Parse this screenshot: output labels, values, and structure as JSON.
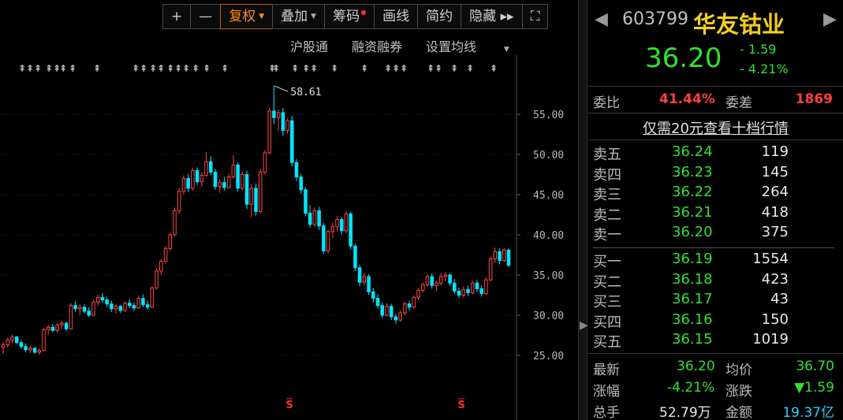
{
  "toolbar": {
    "plus": "+",
    "minus": "—",
    "fuquan": "复权",
    "diejia": "叠加",
    "chouma": "筹码",
    "huaxian": "画线",
    "jianyue": "简约",
    "yincang": "隐藏 ▸▸",
    "expand": "⛶"
  },
  "subbar": {
    "hugutong": "沪股通",
    "rongzi": "融资融券",
    "settings": "设置均线"
  },
  "chart_data": {
    "type": "candlestick",
    "yticks": [
      "55.00",
      "50.00",
      "45.00",
      "40.00",
      "35.00",
      "30.00",
      "25.00"
    ],
    "ylim": [
      20.4,
      60.5
    ],
    "max_label": "58.61",
    "marker_s": "S",
    "candles": [
      [
        26.0,
        26.6,
        25.2,
        26.3
      ],
      [
        26.3,
        27.2,
        26.0,
        26.9
      ],
      [
        26.9,
        27.6,
        26.5,
        27.3
      ],
      [
        27.3,
        27.4,
        26.4,
        26.6
      ],
      [
        26.6,
        26.9,
        25.8,
        26.1
      ],
      [
        26.1,
        26.5,
        25.4,
        25.7
      ],
      [
        25.7,
        26.2,
        25.3,
        25.9
      ],
      [
        25.9,
        26.0,
        25.2,
        25.4
      ],
      [
        25.4,
        25.9,
        25.1,
        25.6
      ],
      [
        25.6,
        28.4,
        25.5,
        28.2
      ],
      [
        28.2,
        28.8,
        27.6,
        28.5
      ],
      [
        28.5,
        28.9,
        27.9,
        28.1
      ],
      [
        28.1,
        29.0,
        27.8,
        28.8
      ],
      [
        28.8,
        29.3,
        28.3,
        29.0
      ],
      [
        29.0,
        29.2,
        28.0,
        28.3
      ],
      [
        28.3,
        31.5,
        28.2,
        31.2
      ],
      [
        31.2,
        31.8,
        30.4,
        30.8
      ],
      [
        30.8,
        31.3,
        30.0,
        31.0
      ],
      [
        31.0,
        31.4,
        30.2,
        30.5
      ],
      [
        30.5,
        31.0,
        29.8,
        30.0
      ],
      [
        30.0,
        31.9,
        29.9,
        31.6
      ],
      [
        31.6,
        32.6,
        31.2,
        32.2
      ],
      [
        32.2,
        32.8,
        31.5,
        31.9
      ],
      [
        31.9,
        32.3,
        31.0,
        31.4
      ],
      [
        31.4,
        31.8,
        30.4,
        30.8
      ],
      [
        30.8,
        31.4,
        30.2,
        31.1
      ],
      [
        31.1,
        31.3,
        30.3,
        30.6
      ],
      [
        30.6,
        31.7,
        30.4,
        31.5
      ],
      [
        31.5,
        32.0,
        30.9,
        31.2
      ],
      [
        31.2,
        31.6,
        30.5,
        30.9
      ],
      [
        30.9,
        32.4,
        30.8,
        32.1
      ],
      [
        32.1,
        32.6,
        31.0,
        31.3
      ],
      [
        31.3,
        31.8,
        30.7,
        31.0
      ],
      [
        31.0,
        33.6,
        30.9,
        33.4
      ],
      [
        33.4,
        35.8,
        33.2,
        35.5
      ],
      [
        35.5,
        37.0,
        35.0,
        36.7
      ],
      [
        36.7,
        38.6,
        36.4,
        38.3
      ],
      [
        38.3,
        40.3,
        38.0,
        40.0
      ],
      [
        40.0,
        43.4,
        39.8,
        43.0
      ],
      [
        43.0,
        45.8,
        42.6,
        45.4
      ],
      [
        45.4,
        47.4,
        45.0,
        47.0
      ],
      [
        47.0,
        47.6,
        45.3,
        45.8
      ],
      [
        45.8,
        48.3,
        45.5,
        48.0
      ],
      [
        48.0,
        48.4,
        46.2,
        46.6
      ],
      [
        46.6,
        47.8,
        46.0,
        47.4
      ],
      [
        47.4,
        50.3,
        47.2,
        49.1
      ],
      [
        49.1,
        49.8,
        47.4,
        47.8
      ],
      [
        47.8,
        48.2,
        45.6,
        46.0
      ],
      [
        46.0,
        46.9,
        45.2,
        46.5
      ],
      [
        46.5,
        47.2,
        45.5,
        45.9
      ],
      [
        45.9,
        47.6,
        45.7,
        47.2
      ],
      [
        47.2,
        49.9,
        47.0,
        48.7
      ],
      [
        48.7,
        49.0,
        45.4,
        45.8
      ],
      [
        45.8,
        47.9,
        45.5,
        47.5
      ],
      [
        47.5,
        48.0,
        43.2,
        43.8
      ],
      [
        43.8,
        46.3,
        42.2,
        45.8
      ],
      [
        45.8,
        46.4,
        42.4,
        42.9
      ],
      [
        42.9,
        48.2,
        42.7,
        47.8
      ],
      [
        47.8,
        50.5,
        47.5,
        50.2
      ],
      [
        50.2,
        55.8,
        50.0,
        55.4
      ],
      [
        55.4,
        58.61,
        53.8,
        54.6
      ],
      [
        54.6,
        55.6,
        53.0,
        55.2
      ],
      [
        55.2,
        55.8,
        52.3,
        53.0
      ],
      [
        53.0,
        54.5,
        52.6,
        54.2
      ],
      [
        54.2,
        54.8,
        48.5,
        49.0
      ],
      [
        49.0,
        49.4,
        46.7,
        47.2
      ],
      [
        47.2,
        47.6,
        45.1,
        45.6
      ],
      [
        45.6,
        45.9,
        42.3,
        42.7
      ],
      [
        42.7,
        43.7,
        40.9,
        41.3
      ],
      [
        41.3,
        43.4,
        41.0,
        43.0
      ],
      [
        43.0,
        43.5,
        40.6,
        41.1
      ],
      [
        41.1,
        41.5,
        37.6,
        38.0
      ],
      [
        38.0,
        40.7,
        37.7,
        40.4
      ],
      [
        40.4,
        41.5,
        39.6,
        41.0
      ],
      [
        41.0,
        42.3,
        40.4,
        41.9
      ],
      [
        41.9,
        42.2,
        40.0,
        40.5
      ],
      [
        40.5,
        43.0,
        40.2,
        42.6
      ],
      [
        42.6,
        42.9,
        38.2,
        38.6
      ],
      [
        38.6,
        38.9,
        35.5,
        35.9
      ],
      [
        35.9,
        36.3,
        33.6,
        34.1
      ],
      [
        34.1,
        35.3,
        33.7,
        34.8
      ],
      [
        34.8,
        35.1,
        32.5,
        32.9
      ],
      [
        32.9,
        33.4,
        31.6,
        32.1
      ],
      [
        32.1,
        32.6,
        30.8,
        31.2
      ],
      [
        31.2,
        31.6,
        29.6,
        30.0
      ],
      [
        30.0,
        31.5,
        29.8,
        31.1
      ],
      [
        31.1,
        31.4,
        29.4,
        29.8
      ],
      [
        29.8,
        30.2,
        28.9,
        29.4
      ],
      [
        29.4,
        30.6,
        29.2,
        30.3
      ],
      [
        30.3,
        31.7,
        30.0,
        31.4
      ],
      [
        31.4,
        31.8,
        30.6,
        31.0
      ],
      [
        31.0,
        32.5,
        30.8,
        32.2
      ],
      [
        32.2,
        33.4,
        31.9,
        33.1
      ],
      [
        33.1,
        34.1,
        32.8,
        33.8
      ],
      [
        33.8,
        35.1,
        33.5,
        34.8
      ],
      [
        34.8,
        35.2,
        33.3,
        33.7
      ],
      [
        33.7,
        34.3,
        33.0,
        34.0
      ],
      [
        34.0,
        35.2,
        33.7,
        34.8
      ],
      [
        34.8,
        35.4,
        34.2,
        35.0
      ],
      [
        35.0,
        35.2,
        33.6,
        34.0
      ],
      [
        34.0,
        34.5,
        32.6,
        33.0
      ],
      [
        33.0,
        33.4,
        32.1,
        32.5
      ],
      [
        32.5,
        33.6,
        32.2,
        33.2
      ],
      [
        33.2,
        33.7,
        32.4,
        32.8
      ],
      [
        32.8,
        34.3,
        32.6,
        34.0
      ],
      [
        34.0,
        34.4,
        32.9,
        33.3
      ],
      [
        33.3,
        33.7,
        32.3,
        32.7
      ],
      [
        32.7,
        34.7,
        32.5,
        34.4
      ],
      [
        34.4,
        37.3,
        34.2,
        37.0
      ],
      [
        37.0,
        38.4,
        36.5,
        37.9
      ],
      [
        37.9,
        38.3,
        36.3,
        36.8
      ],
      [
        36.8,
        38.4,
        36.6,
        38.1
      ],
      [
        38.1,
        38.3,
        36.0,
        36.2
      ]
    ]
  },
  "quote": {
    "code": "603799",
    "name": "华友钴业",
    "price": "36.20",
    "change": "- 1.59",
    "change_pct": "- 4.21%",
    "weibi_label": "委比",
    "weibi": "41.44%",
    "weicha_label": "委差",
    "weicha": "1869",
    "promo": "仅需20元查看十档行情"
  },
  "orderbook": {
    "sells": [
      {
        "name": "卖五",
        "price": "36.24",
        "vol": "119"
      },
      {
        "name": "卖四",
        "price": "36.23",
        "vol": "145"
      },
      {
        "name": "卖三",
        "price": "36.22",
        "vol": "264"
      },
      {
        "name": "卖二",
        "price": "36.21",
        "vol": "418"
      },
      {
        "name": "卖一",
        "price": "36.20",
        "vol": "375"
      }
    ],
    "buys": [
      {
        "name": "买一",
        "price": "36.19",
        "vol": "1554"
      },
      {
        "name": "买二",
        "price": "36.18",
        "vol": "423"
      },
      {
        "name": "买三",
        "price": "36.17",
        "vol": "43"
      },
      {
        "name": "买四",
        "price": "36.16",
        "vol": "150"
      },
      {
        "name": "买五",
        "price": "36.15",
        "vol": "1019"
      }
    ]
  },
  "stats": {
    "latest_label": "最新",
    "latest": "36.20",
    "avg_label": "均价",
    "avg": "36.70",
    "chg_pct_label": "涨幅",
    "chg_pct": "-4.21%",
    "chg_label": "涨跌",
    "chg": "▼1.59",
    "vol_label": "总手",
    "vol": "52.79万",
    "amt_label": "金额",
    "amt": "19.37亿"
  },
  "colors": {
    "up": "#ff4444",
    "down": "#00e5ff",
    "accent": "#ff8a20",
    "name": "#f0d020",
    "green": "#30e030"
  }
}
